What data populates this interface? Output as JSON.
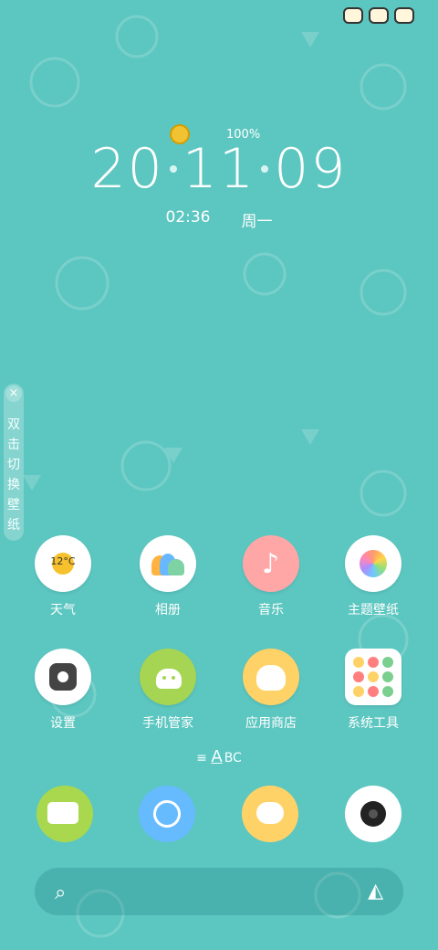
{
  "status_icons": [
    "sun-character-icon",
    "monster-character-icon",
    "robot-character-icon"
  ],
  "clock": {
    "battery": "100%",
    "date_parts": [
      "20",
      "11",
      "09"
    ],
    "time": "02:36",
    "weekday": "周一"
  },
  "side_tab": {
    "close": "×",
    "text": "双击切换壁纸"
  },
  "apps": [
    {
      "label": "天气",
      "temp": "12°C"
    },
    {
      "label": "相册"
    },
    {
      "label": "音乐"
    },
    {
      "label": "主题壁纸"
    },
    {
      "label": "设置"
    },
    {
      "label": "手机管家"
    },
    {
      "label": "应用商店"
    },
    {
      "label": "系统工具"
    }
  ],
  "page_indicator": {
    "prefix": "≡",
    "a": "A",
    "rest": "BC"
  },
  "dock": [
    "phone-icon",
    "browser-icon",
    "messages-icon",
    "camera-icon"
  ],
  "search": {
    "search_icon": "⌕",
    "assistant_icon": "◭"
  },
  "colors": {
    "background": "#5cc6c0",
    "weather_sun": "#f6c12c",
    "music": "#ffa7a7",
    "phone_manager": "#a5d552",
    "app_store": "#ffd268",
    "browser": "#66bbff"
  }
}
